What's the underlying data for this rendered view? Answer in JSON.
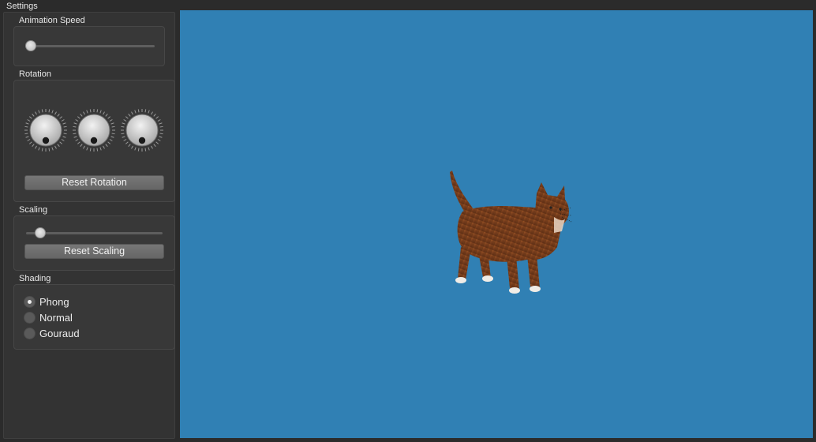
{
  "window": {
    "title": "Settings"
  },
  "settings": {
    "animation_speed": {
      "label": "Animation Speed",
      "value": 0.0
    },
    "rotation": {
      "label": "Rotation",
      "dials": [
        {
          "name": "rotation-x-dial",
          "value": 0
        },
        {
          "name": "rotation-y-dial",
          "value": 0
        },
        {
          "name": "rotation-z-dial",
          "value": 0
        }
      ],
      "reset_label": "Reset Rotation"
    },
    "scaling": {
      "label": "Scaling",
      "value": 0.07,
      "reset_label": "Reset Scaling"
    },
    "shading": {
      "label": "Shading",
      "options": [
        {
          "label": "Phong",
          "checked": true
        },
        {
          "label": "Normal",
          "checked": false
        },
        {
          "label": "Gouraud",
          "checked": false
        }
      ]
    }
  },
  "viewport": {
    "background": "#3080b4",
    "model": "cat-icon"
  }
}
